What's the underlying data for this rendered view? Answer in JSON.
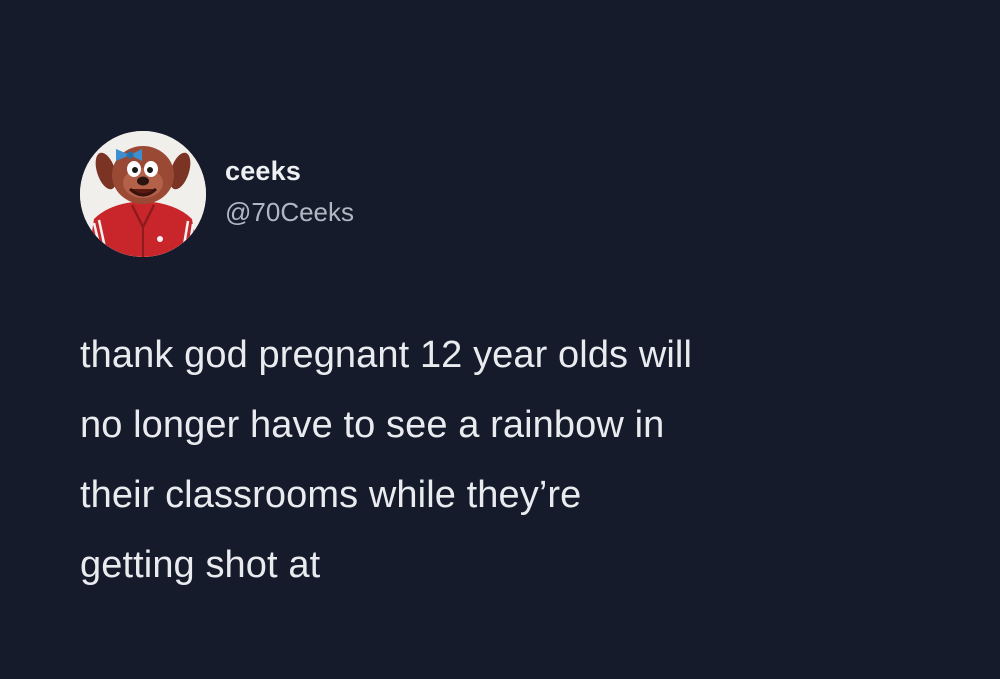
{
  "tweet": {
    "author": {
      "display_name": "ceeks",
      "handle": "@70Ceeks",
      "avatar_icon": "muppet-avatar-icon"
    },
    "text_lines": [
      "thank god pregnant 12 year olds will",
      "no longer have to see a rainbow in",
      "their classrooms while they’re",
      "getting shot at"
    ]
  },
  "colors": {
    "background": "#151b2b",
    "text_primary": "#e9ebef",
    "text_secondary": "#b1b7c2",
    "avatar_jacket": "#c8262a"
  }
}
